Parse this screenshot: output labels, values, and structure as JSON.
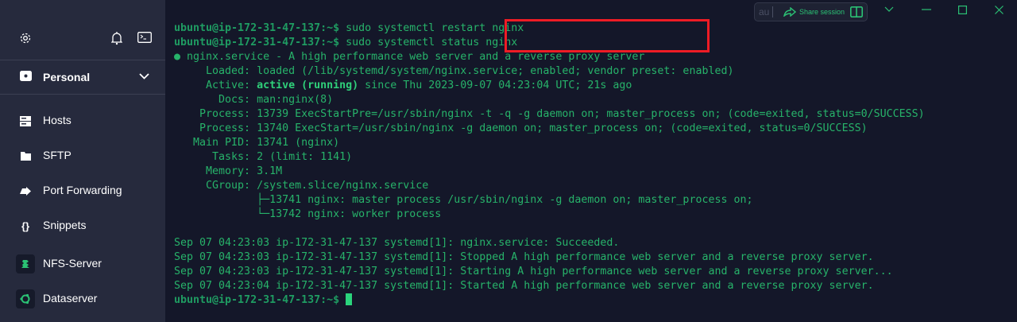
{
  "colors": {
    "accent": "#2bc174",
    "terminal_bg": "#141729",
    "sidebar_bg": "#262a3d",
    "highlight": "#ee1c25"
  },
  "sidebar": {
    "top_icons": [
      "gear-icon",
      "bell-icon",
      "terminal-icon"
    ],
    "vault": {
      "label": "Personal",
      "icon": "vault-icon"
    },
    "items": [
      {
        "label": "Hosts",
        "icon": "hosts-icon"
      },
      {
        "label": "SFTP",
        "icon": "folder-icon"
      },
      {
        "label": "Port Forwarding",
        "icon": "port-forward-icon"
      },
      {
        "label": "Snippets",
        "icon": "braces-icon",
        "glyph": "{}"
      },
      {
        "label": "NFS-Server",
        "icon": "host-icon"
      },
      {
        "label": "Dataserver",
        "icon": "ubuntu-icon"
      }
    ]
  },
  "titlebar": {
    "input_text": "au",
    "share_label": "Share session"
  },
  "terminal": {
    "prompt": "ubuntu@ip-172-31-47-137:~$",
    "commands": [
      "sudo systemctl restart nginx",
      "sudo systemctl status nginx"
    ],
    "status_lines": [
      "● nginx.service - A high performance web server and a reverse proxy server",
      "     Loaded: loaded (/lib/systemd/system/nginx.service; enabled; vendor preset: enabled)"
    ],
    "active_label": "     Active: ",
    "active_state": "active (running)",
    "active_rest": " since Thu 2023-09-07 04:23:04 UTC; 21s ago",
    "more_lines": [
      "       Docs: man:nginx(8)",
      "    Process: 13739 ExecStartPre=/usr/sbin/nginx -t -q -g daemon on; master_process on; (code=exited, status=0/SUCCESS)",
      "    Process: 13740 ExecStart=/usr/sbin/nginx -g daemon on; master_process on; (code=exited, status=0/SUCCESS)",
      "   Main PID: 13741 (nginx)",
      "      Tasks: 2 (limit: 1141)",
      "     Memory: 3.1M",
      "     CGroup: /system.slice/nginx.service",
      "             ├─13741 nginx: master process /usr/sbin/nginx -g daemon on; master_process on;",
      "             └─13742 nginx: worker process",
      "",
      "Sep 07 04:23:03 ip-172-31-47-137 systemd[1]: nginx.service: Succeeded.",
      "Sep 07 04:23:03 ip-172-31-47-137 systemd[1]: Stopped A high performance web server and a reverse proxy server.",
      "Sep 07 04:23:03 ip-172-31-47-137 systemd[1]: Starting A high performance web server and a reverse proxy server...",
      "Sep 07 04:23:04 ip-172-31-47-137 systemd[1]: Started A high performance web server and a reverse proxy server."
    ]
  }
}
